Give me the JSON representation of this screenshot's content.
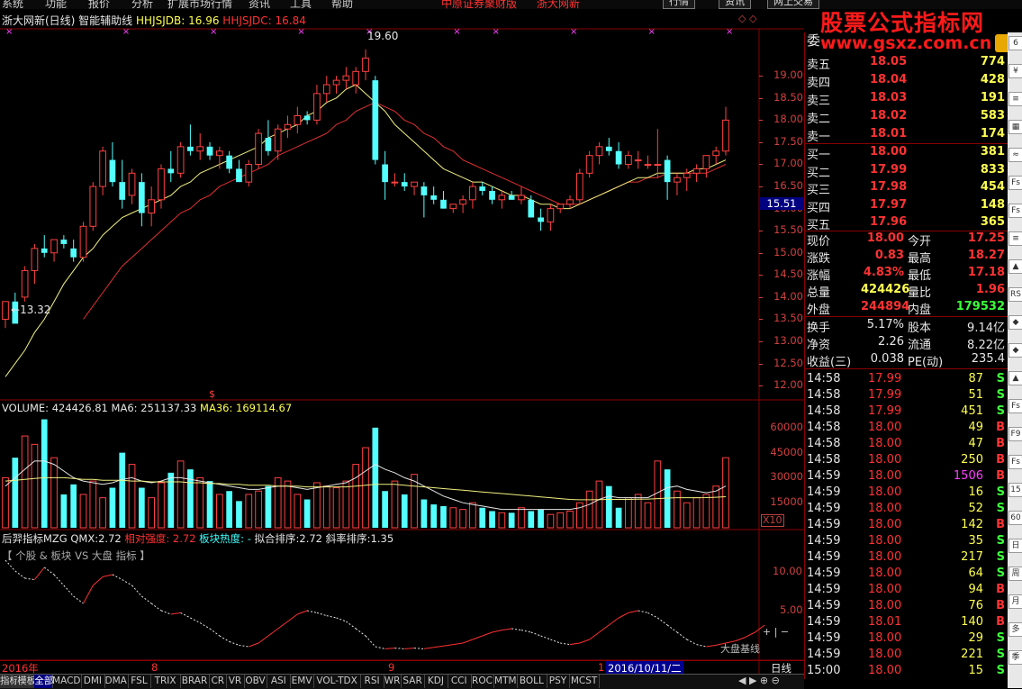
{
  "menu": [
    "系统",
    "功能",
    "报价",
    "分析",
    "扩展市场行情",
    "资讯",
    "工具",
    "帮助"
  ],
  "menu_center": [
    "中原证券聚财版",
    "浙大网新"
  ],
  "top_buttons": [
    "行情",
    "资讯",
    "网上交易"
  ],
  "logo": {
    "title": "股票公式指标网",
    "url": "www.gsxz.com.cn"
  },
  "title": {
    "name": "浙大网新(日线) 智能辅助线",
    "hhjsjdb_label": "HHJSJDB:",
    "hhjsjdb_value": "16.96",
    "hhjsjdc_label": "HHJSJDC:",
    "hhjsjdc_value": "16.84"
  },
  "price_axis": [
    "19.00",
    "18.50",
    "18.00",
    "17.50",
    "17.00",
    "16.50",
    "16.00",
    "15.50",
    "15.00",
    "14.50",
    "14.00",
    "13.50",
    "13.00",
    "12.50",
    "12.00"
  ],
  "price_marker": "15.51",
  "high_label": "19.60",
  "low_label": "13.32",
  "volume": {
    "label": "VOLUME:",
    "value": "424426.81",
    "ma6_label": "MA6:",
    "ma6_value": "251137.33",
    "ma36_label": "MA36:",
    "ma36_value": "169114.67",
    "axis": [
      "60000",
      "45000",
      "30000",
      "15000"
    ],
    "x10": "X10"
  },
  "indicator": {
    "name": "后羿指标MZG",
    "qmx_label": "QMX:",
    "qmx_value": "2.72",
    "rel_label": "相对强度:",
    "rel_value": "2.72",
    "heat_label": "板块热度:",
    "heat_value": "-",
    "fit_label": "拟合排序:",
    "fit_value": "2.72",
    "slope_label": "斜率排序:",
    "slope_value": "1.35",
    "subtitle": "【 个股 & 板块 VS 大盘 指标 】",
    "axis": [
      "10.00",
      "5.00"
    ],
    "corner_label": "大盘基线"
  },
  "date_axis": {
    "year": "2016年",
    "m8": "8",
    "m9": "9",
    "m10": "1",
    "cursor_date": "2016/10/11/二",
    "period": "日线"
  },
  "bottom_tabs": [
    "指标",
    "模板",
    "全部",
    "MACD",
    "DMI",
    "DMA",
    "FSL",
    "TRIX",
    "BRAR",
    "CR",
    "VR",
    "OBV",
    "ASI",
    "EMV",
    "VOL-TDX",
    "RSI",
    "WR",
    "SAR",
    "KDJ",
    "CCI",
    "ROC",
    "MTM",
    "BOLL",
    "PSY",
    "MCST"
  ],
  "quote": {
    "sell_header": "委",
    "sell": [
      {
        "label": "卖五",
        "price": "18.05",
        "vol": "774"
      },
      {
        "label": "卖四",
        "price": "18.04",
        "vol": "428"
      },
      {
        "label": "卖三",
        "price": "18.03",
        "vol": "191"
      },
      {
        "label": "卖二",
        "price": "18.02",
        "vol": "583"
      },
      {
        "label": "卖一",
        "price": "18.01",
        "vol": "174"
      }
    ],
    "buy": [
      {
        "label": "买一",
        "price": "18.00",
        "vol": "381"
      },
      {
        "label": "买二",
        "price": "17.99",
        "vol": "833"
      },
      {
        "label": "买三",
        "price": "17.98",
        "vol": "454"
      },
      {
        "label": "买四",
        "price": "17.97",
        "vol": "148"
      },
      {
        "label": "买五",
        "price": "17.96",
        "vol": "365"
      }
    ],
    "stats": [
      {
        "l1": "现价",
        "v1": "18.00",
        "c1": "red",
        "l2": "今开",
        "v2": "17.25",
        "c2": "red"
      },
      {
        "l1": "涨跌",
        "v1": "0.83",
        "c1": "red",
        "l2": "最高",
        "v2": "18.27",
        "c2": "red"
      },
      {
        "l1": "涨幅",
        "v1": "4.83%",
        "c1": "red",
        "l2": "最低",
        "v2": "17.18",
        "c2": "red"
      },
      {
        "l1": "总量",
        "v1": "424426",
        "c1": "yellow",
        "l2": "量比",
        "v2": "1.96",
        "c2": "red"
      },
      {
        "l1": "外盘",
        "v1": "244894",
        "c1": "red",
        "l2": "内盘",
        "v2": "179532",
        "c2": "green"
      }
    ],
    "stats2": [
      {
        "l1": "换手",
        "v1": "5.17%",
        "l2": "股本",
        "v2": "9.14亿"
      },
      {
        "l1": "净资",
        "v1": "2.26",
        "l2": "流通",
        "v2": "8.22亿"
      },
      {
        "l1": "收益(三)",
        "v1": "0.038",
        "l2": "PE(动)",
        "v2": "235.4"
      }
    ],
    "ticks": [
      {
        "t": "14:58",
        "p": "17.99",
        "v": "87",
        "s": "S"
      },
      {
        "t": "14:58",
        "p": "17.99",
        "v": "51",
        "s": "S"
      },
      {
        "t": "14:58",
        "p": "17.99",
        "v": "451",
        "s": "S"
      },
      {
        "t": "14:58",
        "p": "18.00",
        "v": "49",
        "s": "B"
      },
      {
        "t": "14:58",
        "p": "18.00",
        "v": "47",
        "s": "B"
      },
      {
        "t": "14:58",
        "p": "18.00",
        "v": "250",
        "s": "B"
      },
      {
        "t": "14:59",
        "p": "18.00",
        "v": "1506",
        "s": "B"
      },
      {
        "t": "14:59",
        "p": "18.00",
        "v": "16",
        "s": "S"
      },
      {
        "t": "14:59",
        "p": "18.00",
        "v": "52",
        "s": "S"
      },
      {
        "t": "14:59",
        "p": "18.00",
        "v": "142",
        "s": "B"
      },
      {
        "t": "14:59",
        "p": "18.00",
        "v": "35",
        "s": "S"
      },
      {
        "t": "14:59",
        "p": "18.00",
        "v": "217",
        "s": "S"
      },
      {
        "t": "14:59",
        "p": "18.00",
        "v": "64",
        "s": "S"
      },
      {
        "t": "14:59",
        "p": "18.00",
        "v": "94",
        "s": "B"
      },
      {
        "t": "14:59",
        "p": "18.00",
        "v": "76",
        "s": "B"
      },
      {
        "t": "14:59",
        "p": "18.01",
        "v": "140",
        "s": "B"
      },
      {
        "t": "14:59",
        "p": "18.00",
        "v": "29",
        "s": "S"
      },
      {
        "t": "14:59",
        "p": "18.00",
        "v": "221",
        "s": "S"
      },
      {
        "t": "15:00",
        "p": "18.00",
        "v": "15",
        "s": "S"
      }
    ]
  },
  "right_strip": [
    "6",
    "¥",
    "≡",
    "▦",
    "≈",
    "Fs",
    "Fs",
    "≡",
    "▲",
    "RS",
    "◆",
    "◆",
    "▲",
    "Fs",
    "F9",
    "Fs",
    "15",
    "60",
    "日",
    "周",
    "月",
    "多",
    "季"
  ],
  "chart_data": {
    "type": "candlestick",
    "ylim": [
      11.8,
      19.9
    ],
    "candles": [
      [
        13.5,
        13.9,
        13.3,
        13.9
      ],
      [
        13.9,
        14.1,
        13.6,
        13.4
      ],
      [
        14.0,
        14.7,
        13.9,
        14.6
      ],
      [
        14.6,
        15.2,
        14.3,
        15.1
      ],
      [
        15.1,
        15.4,
        14.9,
        15.0
      ],
      [
        15.0,
        15.2,
        14.8,
        15.3
      ],
      [
        15.3,
        15.4,
        15.1,
        15.2
      ],
      [
        15.1,
        15.3,
        14.8,
        14.9
      ],
      [
        14.9,
        15.7,
        14.8,
        15.6
      ],
      [
        15.6,
        16.6,
        15.5,
        16.5
      ],
      [
        16.5,
        17.4,
        16.3,
        17.3
      ],
      [
        17.1,
        17.5,
        16.5,
        16.6
      ],
      [
        16.6,
        17.1,
        16.0,
        16.2
      ],
      [
        16.3,
        16.9,
        16.1,
        16.8
      ],
      [
        16.6,
        16.8,
        15.6,
        15.9
      ],
      [
        15.9,
        16.5,
        15.6,
        16.2
      ],
      [
        16.2,
        17.0,
        16.0,
        16.9
      ],
      [
        16.9,
        17.3,
        16.6,
        16.8
      ],
      [
        16.8,
        17.5,
        16.7,
        17.4
      ],
      [
        17.4,
        17.9,
        17.2,
        17.3
      ],
      [
        17.3,
        17.7,
        17.1,
        17.4
      ],
      [
        17.4,
        17.5,
        17.1,
        17.2
      ],
      [
        17.2,
        17.4,
        16.9,
        17.3
      ],
      [
        17.2,
        17.3,
        16.8,
        16.9
      ],
      [
        16.9,
        17.1,
        16.6,
        16.6
      ],
      [
        16.6,
        17.1,
        16.5,
        17.0
      ],
      [
        17.0,
        17.8,
        16.9,
        17.7
      ],
      [
        17.6,
        18.0,
        17.2,
        17.3
      ],
      [
        17.3,
        17.9,
        17.1,
        17.8
      ],
      [
        17.8,
        18.1,
        17.6,
        17.9
      ],
      [
        17.9,
        18.3,
        17.7,
        18.1
      ],
      [
        18.1,
        18.2,
        17.9,
        18.0
      ],
      [
        18.0,
        18.8,
        17.9,
        18.6
      ],
      [
        18.6,
        19.0,
        18.4,
        18.8
      ],
      [
        18.8,
        19.0,
        18.6,
        18.9
      ],
      [
        18.9,
        19.2,
        18.7,
        19.0
      ],
      [
        18.8,
        19.2,
        18.6,
        19.1
      ],
      [
        19.1,
        19.6,
        18.9,
        19.4
      ],
      [
        18.9,
        19.0,
        17.0,
        17.1
      ],
      [
        17.0,
        17.3,
        16.2,
        16.6
      ],
      [
        16.6,
        16.8,
        16.5,
        16.6
      ],
      [
        16.6,
        16.8,
        16.4,
        16.5
      ],
      [
        16.5,
        16.6,
        16.3,
        16.6
      ],
      [
        16.5,
        16.6,
        15.8,
        16.3
      ],
      [
        16.3,
        16.5,
        16.1,
        16.2
      ],
      [
        16.2,
        16.4,
        16.0,
        16.0
      ],
      [
        16.0,
        16.1,
        15.9,
        16.1
      ],
      [
        16.1,
        16.3,
        15.9,
        16.2
      ],
      [
        16.2,
        16.6,
        16.0,
        16.5
      ],
      [
        16.5,
        16.6,
        16.3,
        16.4
      ],
      [
        16.4,
        16.5,
        16.1,
        16.2
      ],
      [
        16.2,
        16.4,
        16.0,
        16.3
      ],
      [
        16.3,
        16.4,
        16.2,
        16.2
      ],
      [
        16.2,
        16.5,
        16.1,
        16.3
      ],
      [
        16.2,
        16.3,
        15.8,
        15.8
      ],
      [
        15.8,
        16.0,
        15.5,
        15.7
      ],
      [
        15.7,
        16.1,
        15.5,
        16.0
      ],
      [
        16.0,
        16.1,
        15.9,
        16.1
      ],
      [
        16.1,
        16.3,
        16.0,
        16.2
      ],
      [
        16.2,
        16.9,
        16.1,
        16.8
      ],
      [
        16.8,
        17.3,
        16.7,
        17.2
      ],
      [
        17.2,
        17.5,
        17.0,
        17.4
      ],
      [
        17.4,
        17.6,
        17.2,
        17.3
      ],
      [
        17.3,
        17.5,
        16.9,
        17.0
      ],
      [
        17.0,
        17.3,
        16.9,
        17.2
      ],
      [
        17.1,
        17.3,
        16.9,
        17.1
      ],
      [
        17.0,
        17.2,
        16.9,
        17.0
      ],
      [
        17.0,
        17.8,
        16.7,
        17.0
      ],
      [
        17.1,
        17.2,
        16.2,
        16.6
      ],
      [
        16.6,
        16.8,
        16.3,
        16.7
      ],
      [
        16.7,
        16.9,
        16.4,
        16.8
      ],
      [
        16.8,
        17.0,
        16.6,
        16.9
      ],
      [
        16.9,
        17.2,
        16.7,
        17.2
      ],
      [
        17.2,
        17.4,
        17.0,
        17.3
      ],
      [
        17.3,
        18.3,
        17.2,
        18.0
      ]
    ],
    "ma_fast": [
      12.2,
      12.5,
      12.8,
      13.2,
      13.5,
      13.9,
      14.3,
      14.6,
      14.9,
      15.1,
      15.4,
      15.6,
      15.8,
      15.9,
      16.0,
      16.1,
      16.2,
      16.3,
      16.5,
      16.6,
      16.8,
      16.9,
      17.0,
      17.1,
      17.2,
      17.3,
      17.4,
      17.6,
      17.7,
      17.8,
      17.9,
      18.1,
      18.2,
      18.4,
      18.5,
      18.7,
      18.8,
      18.6,
      18.4,
      18.2,
      17.9,
      17.7,
      17.5,
      17.3,
      17.1,
      16.9,
      16.8,
      16.7,
      16.6,
      16.6,
      16.5,
      16.4,
      16.3,
      16.3,
      16.2,
      16.1,
      16.1,
      16.0,
      16.0,
      16.1,
      16.2,
      16.3,
      16.4,
      16.5,
      16.6,
      16.7,
      16.7,
      16.8,
      16.8,
      16.8,
      16.8,
      16.9,
      16.9,
      17.0,
      17.1
    ],
    "ma_slow": [
      null,
      null,
      null,
      null,
      null,
      null,
      null,
      null,
      13.5,
      13.8,
      14.1,
      14.4,
      14.7,
      14.9,
      15.1,
      15.3,
      15.5,
      15.7,
      15.9,
      16.0,
      16.2,
      16.3,
      16.5,
      16.6,
      16.7,
      16.8,
      16.9,
      17.0,
      17.2,
      17.3,
      17.4,
      17.5,
      17.6,
      17.7,
      17.9,
      18.0,
      18.2,
      18.3,
      18.4,
      18.3,
      18.2,
      18.0,
      17.9,
      17.7,
      17.6,
      17.4,
      17.3,
      17.1,
      17.0,
      16.9,
      16.8,
      16.7,
      16.6,
      16.5,
      16.4,
      16.3,
      16.2,
      16.1,
      16.1,
      16.1,
      16.2,
      16.3,
      16.4,
      16.5,
      16.6,
      16.6,
      16.7,
      16.7,
      16.8,
      16.8,
      16.8,
      16.8,
      16.8,
      16.9,
      17.0
    ],
    "volumes": [
      30000,
      42000,
      55000,
      50000,
      65000,
      42000,
      20000,
      26000,
      20000,
      28000,
      18000,
      24000,
      45000,
      38000,
      24000,
      18000,
      27000,
      33000,
      40000,
      35000,
      30000,
      28000,
      20000,
      22000,
      16000,
      20000,
      22000,
      25000,
      30000,
      28000,
      20000,
      17000,
      27000,
      25000,
      24000,
      28000,
      38000,
      48000,
      60000,
      22000,
      28000,
      20000,
      32000,
      17000,
      14000,
      13000,
      12000,
      11000,
      15000,
      12000,
      10000,
      9000,
      9000,
      12000,
      10000,
      11000,
      8000,
      9000,
      10000,
      15000,
      22000,
      28000,
      25000,
      12000,
      18000,
      20000,
      15000,
      40000,
      35000,
      22000,
      15000,
      18000,
      20000,
      25000,
      42000
    ],
    "volume_ylim": [
      0,
      68000
    ],
    "vol_ma_fast": [
      25000,
      30000,
      35000,
      40000,
      40000,
      38000,
      34000,
      30000,
      28000,
      27000,
      26000,
      27000,
      29000,
      30000,
      28000,
      27000,
      28000,
      30000,
      30000,
      29000,
      28000,
      27000,
      26000,
      25000,
      24000,
      23000,
      23000,
      24000,
      25000,
      25000,
      24000,
      23000,
      24000,
      25000,
      26000,
      27000,
      30000,
      34000,
      38000,
      35000,
      33000,
      30000,
      28000,
      25000,
      22000,
      19000,
      17000,
      15000,
      14000,
      13000,
      12000,
      11000,
      11000,
      11000,
      11000,
      11000,
      11000,
      11000,
      11000,
      12000,
      14000,
      17000,
      19000,
      18000,
      18000,
      18000,
      18000,
      21000,
      24000,
      25000,
      23000,
      22000,
      21000,
      22000,
      25000
    ],
    "vol_ma_slow": [
      28000,
      28500,
      29000,
      29500,
      30000,
      30000,
      30000,
      29500,
      29000,
      29000,
      28500,
      28500,
      28500,
      28000,
      28000,
      27500,
      27500,
      27500,
      27500,
      27000,
      27000,
      26500,
      26500,
      26000,
      26000,
      25500,
      25500,
      25500,
      25000,
      25000,
      25000,
      24500,
      24500,
      24500,
      24500,
      24500,
      25000,
      25500,
      26000,
      26000,
      26000,
      25500,
      25000,
      24500,
      24000,
      23500,
      23000,
      22500,
      22000,
      21500,
      21000,
      20500,
      20000,
      19500,
      19000,
      18500,
      18000,
      17500,
      17000,
      16800,
      16800,
      16900,
      17000,
      17000,
      17000,
      17100,
      17200,
      17500,
      17800,
      18000,
      18000,
      18000,
      18100,
      18300,
      18600
    ],
    "indicator_ylim": [
      -1,
      14
    ],
    "indicator": [
      12.5,
      11.0,
      10.0,
      9.8,
      11.5,
      10.5,
      9.0,
      7.5,
      6.5,
      9.0,
      10.2,
      10.5,
      9.8,
      9.0,
      7.5,
      6.5,
      5.5,
      5.0,
      5.2,
      4.5,
      3.8,
      3.0,
      2.0,
      1.2,
      0.7,
      0.5,
      1.0,
      2.0,
      3.0,
      4.0,
      5.0,
      5.5,
      5.2,
      4.8,
      4.5,
      4.0,
      3.0,
      2.0,
      0.5,
      0.2,
      0.3,
      0.2,
      0.3,
      0.2,
      0.4,
      0.6,
      0.8,
      1.0,
      1.5,
      2.0,
      2.5,
      2.8,
      3.0,
      2.8,
      2.5,
      2.0,
      1.5,
      1.0,
      0.8,
      1.0,
      1.5,
      2.5,
      3.5,
      4.5,
      5.2,
      5.5,
      5.2,
      4.5,
      3.5,
      2.5,
      1.5,
      0.8,
      0.5,
      0.7,
      1.0,
      1.3,
      1.8,
      2.5,
      3.5
    ]
  }
}
